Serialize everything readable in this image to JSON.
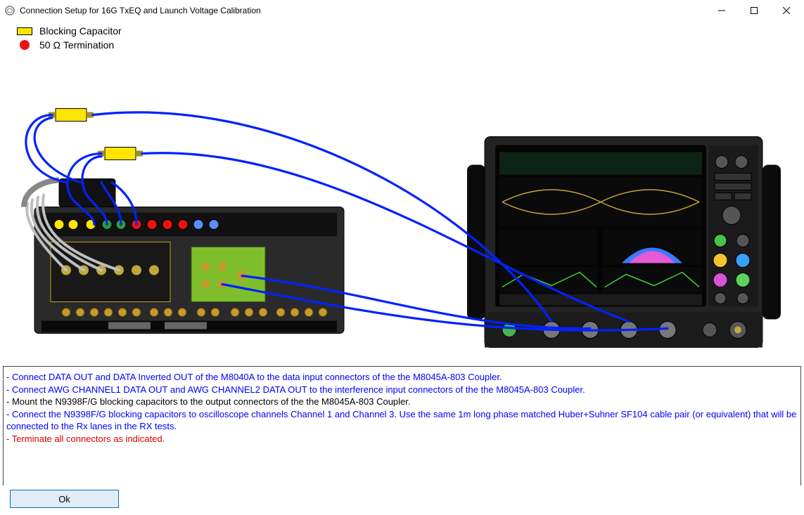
{
  "window": {
    "title": "Connection Setup for 16G TxEQ and Launch Voltage Calibration"
  },
  "legend": {
    "blocking": "Blocking Capacitor",
    "termination": "50 Ω Termination"
  },
  "instructions": [
    {
      "color": "#0000ff",
      "text": "- Connect DATA OUT and DATA Inverted OUT of the M8040A to the data input connectors of the the M8045A-803 Coupler."
    },
    {
      "color": "#0000ff",
      "text": "- Connect AWG CHANNEL1 DATA OUT and AWG CHANNEL2 DATA OUT to the interference input connectors of the the M8045A-803 Coupler."
    },
    {
      "color": "#000000",
      "text": "- Mount the N9398F/G blocking capacitors to the output connectors of the the M8045A-803 Coupler."
    },
    {
      "color": "#0000ff",
      "text": "- Connect the N9398F/G blocking capacitors to oscilloscope channels Channel 1 and Channel 3. Use the same 1m long phase matched Huber+Suhner SF104 cable pair (or equivalent) that will be connected to the Rx lanes in the RX tests."
    },
    {
      "color": "#000000",
      "text": ""
    },
    {
      "color": "#d40000",
      "text": "- Terminate all connectors as indicated."
    }
  ],
  "buttons": {
    "ok": "Ok"
  }
}
